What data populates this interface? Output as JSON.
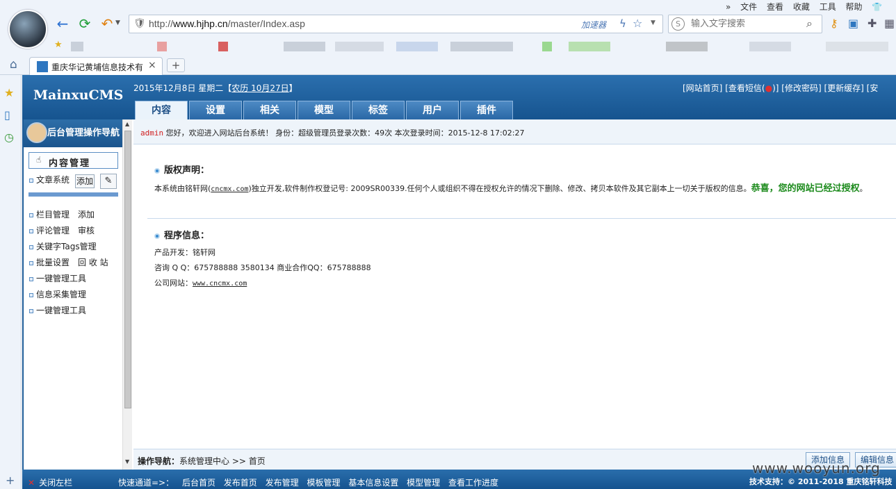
{
  "browser": {
    "url_prefix": "http://",
    "url_domain": "www.hjhp.cn",
    "url_path": "/master/Index.asp",
    "accelerator": "加速器",
    "search_placeholder": "输入文字搜索",
    "menu": [
      "文件",
      "查看",
      "收藏",
      "工具",
      "帮助"
    ],
    "tab_title": "重庆华记黄埔信息技术有",
    "new_tab": "+"
  },
  "header": {
    "logo": "MainxuCMS",
    "date_prefix": "2015年12月8日 星期二【",
    "lunar": "农历 10月27日",
    "date_suffix": "】",
    "links": [
      "[网站首页]",
      "[查看短信(",
      ")]",
      "[修改密码]",
      "[更新缓存]",
      "[安"
    ],
    "sms_badge": "●",
    "nav_tabs": [
      "内容",
      "设置",
      "相关",
      "模型",
      "标签",
      "用户",
      "插件"
    ]
  },
  "sidebar": {
    "title": "后台管理操作导航",
    "section": "内容管理",
    "article_label": "文章系统",
    "add_button": "添加",
    "items": [
      "栏目管理　添加",
      "评论管理　审核",
      "关键字Tags管理",
      "批量设置　回 收 站",
      "一键管理工具",
      "信息采集管理",
      "一键管理工具"
    ]
  },
  "welcome": {
    "user": "admin",
    "text": " 您好，欢迎进入网站后台系统！ 身份：超级管理员登录次数：49次 本次登录时间：2015-12-8 17:02:27"
  },
  "copyright": {
    "title": "版权声明：",
    "text_before_link": "本系统由铭轩网(",
    "link": "cncmx.com",
    "text_after_link": ")独立开发,软件制作权登记号: 2009SR00339.任何个人或组织不得在授权允许的情况下删除、修改、拷贝本软件及其它副本上一切关于版权的信息。",
    "congrats": "恭喜，您的网站已经过授权",
    "period": "。"
  },
  "program": {
    "title": "程序信息：",
    "dev": "产品开发：铭轩网",
    "qq": "咨询 Q Q：675788888 3580134 商业合作QQ：675788888",
    "site_label": "公司网站：",
    "site_link": "www.cncmx.com"
  },
  "opnav": {
    "label": "操作导航：",
    "path": "系统管理中心 >> 首页",
    "add_info": "添加信息",
    "edit_info": "编辑信息"
  },
  "bottom": {
    "close_left": "关闭左栏",
    "close_x": "✕",
    "quick_label": "快速通道=>：",
    "quick_links": [
      "后台首页",
      "发布首页",
      "发布管理",
      "模板管理",
      "基本信息设置",
      "模型管理",
      "查看工作进度"
    ],
    "tech_support": "技术支持：© 2011-2018 重庆铭轩科技"
  },
  "watermark": "www.wooyun.org"
}
